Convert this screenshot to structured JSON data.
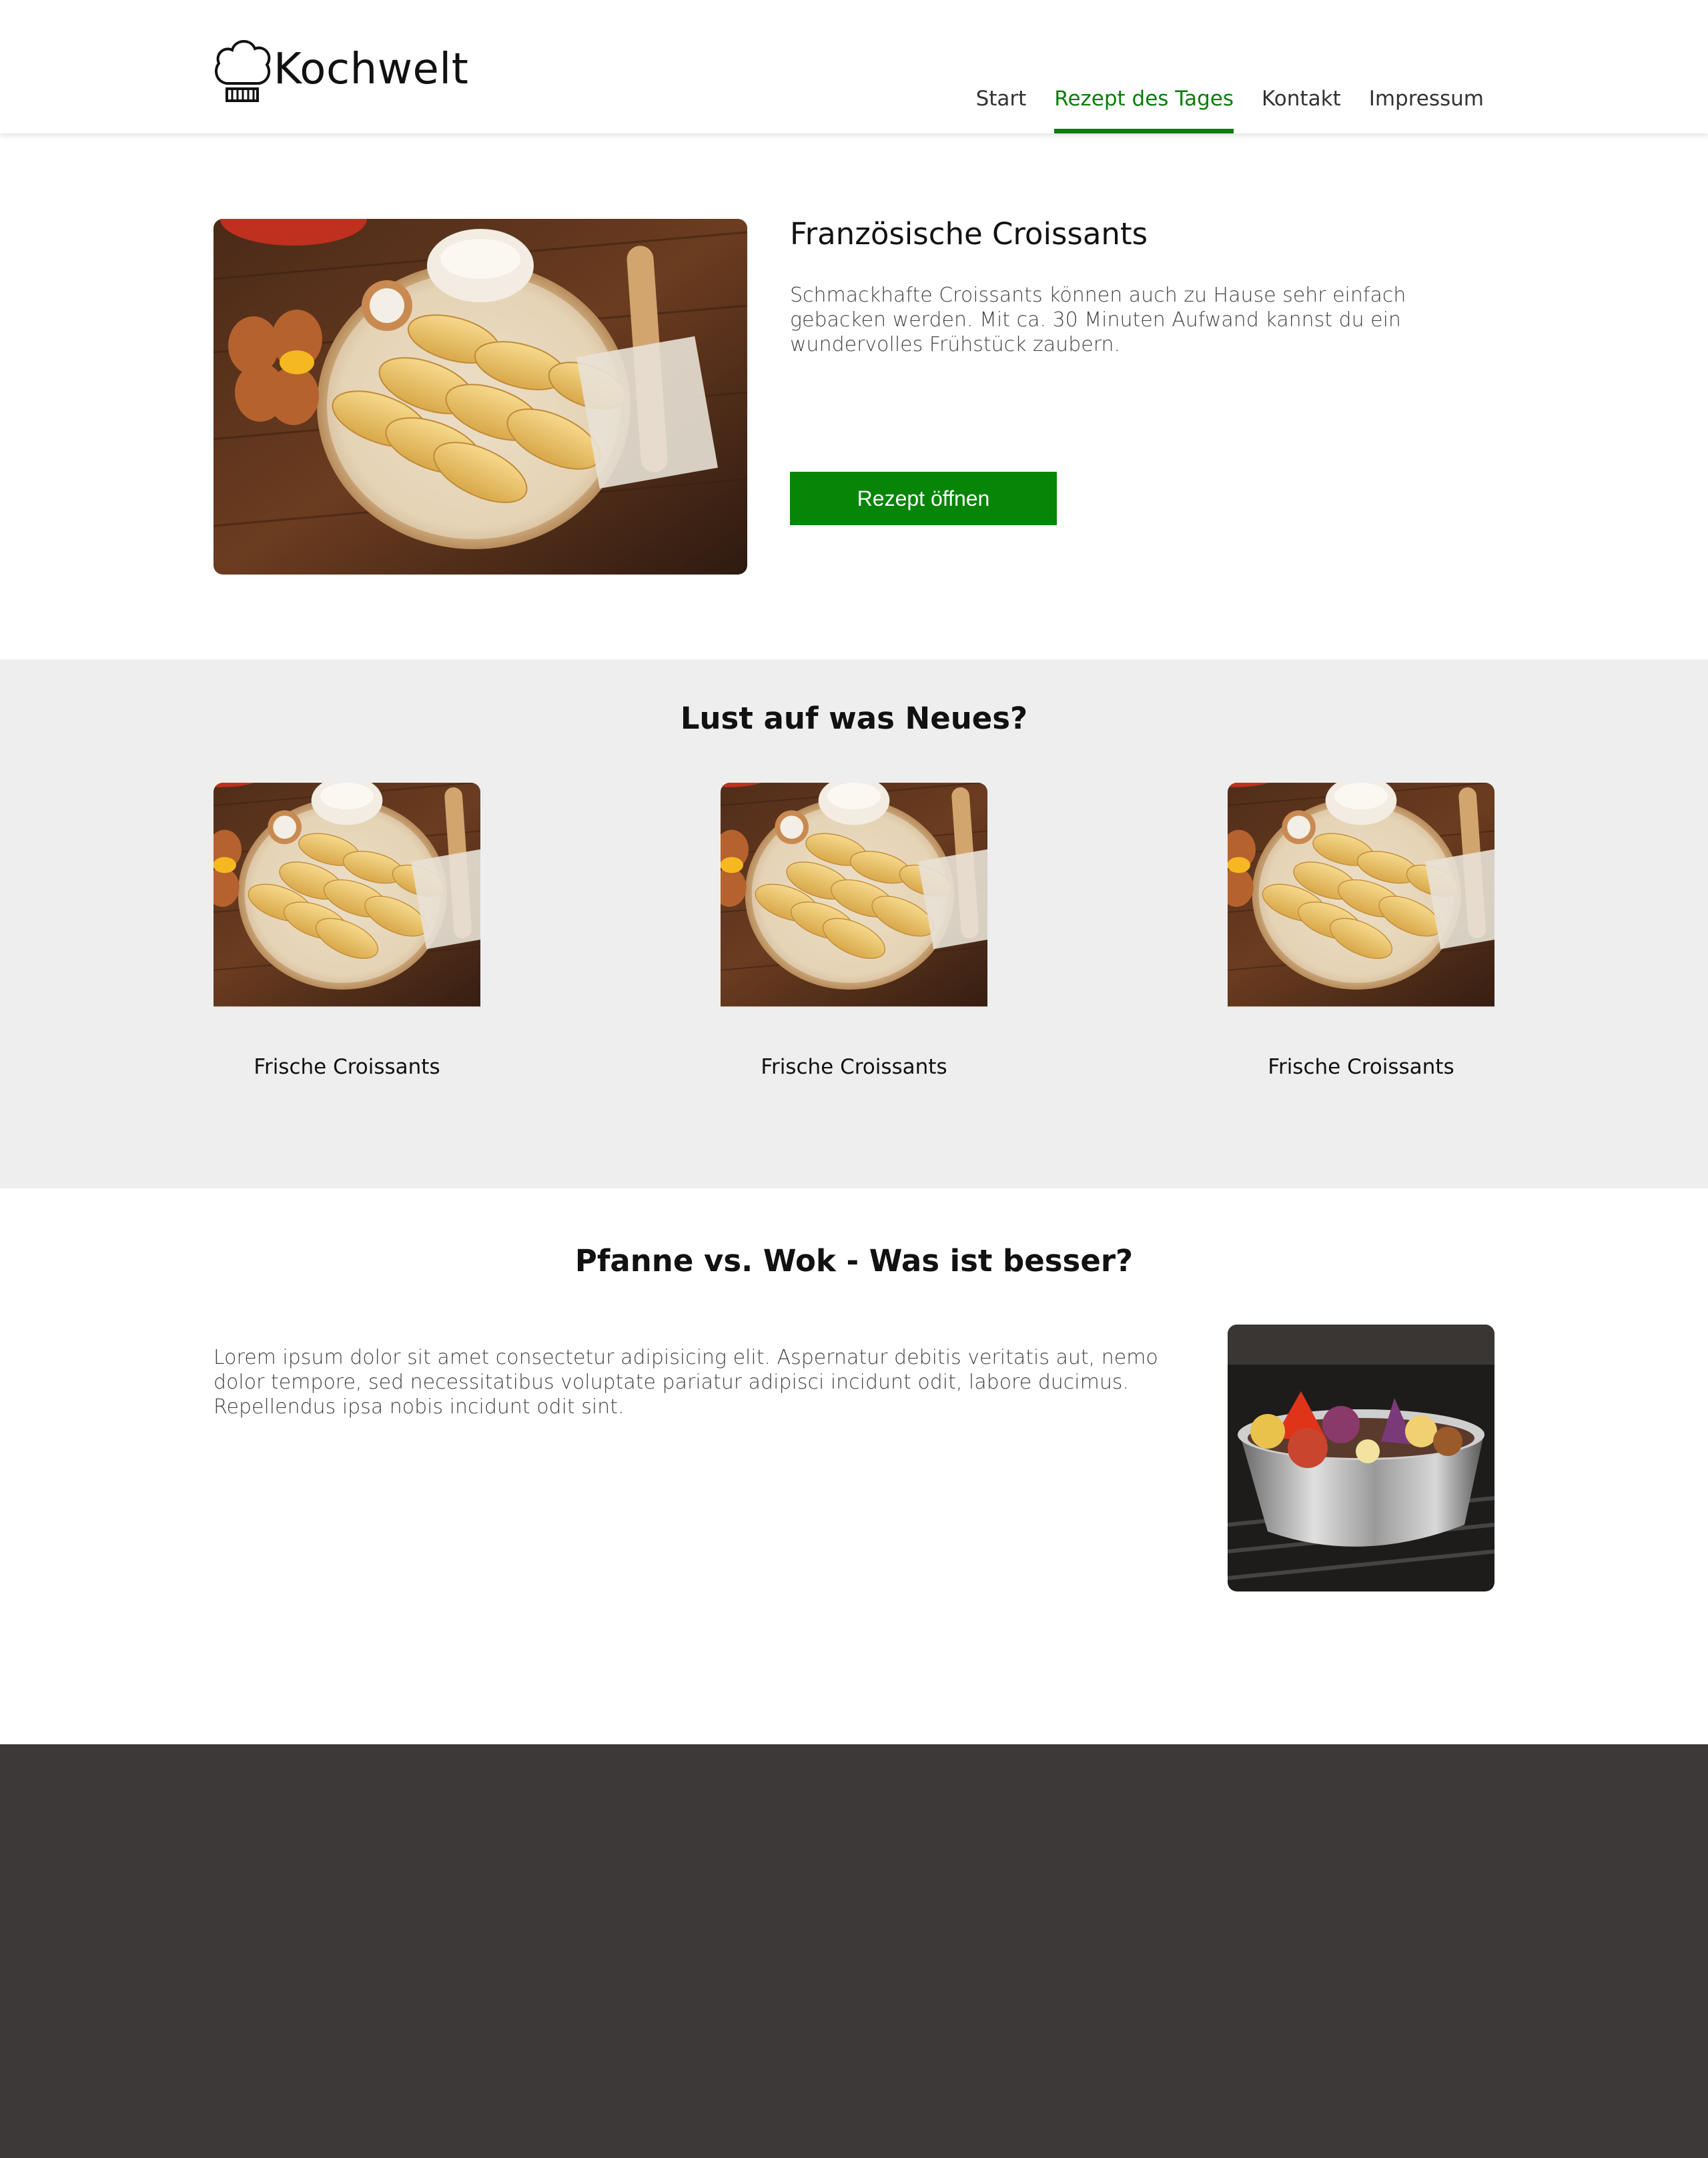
{
  "brand": {
    "name": "Kochwelt",
    "logo_icon": "chef-hat-icon"
  },
  "nav": {
    "items": [
      {
        "label": "Start",
        "active": false
      },
      {
        "label": "Rezept des Tages",
        "active": true
      },
      {
        "label": "Kontakt",
        "active": false
      },
      {
        "label": "Impressum",
        "active": false
      }
    ],
    "active_color": "#0a7d0a"
  },
  "recipe_of_day": {
    "title": "Französische Croissants",
    "description": "Schmackhafte Croissants können auch zu Hause sehr einfach gebacken werden. Mit ca. 30 Minuten Aufwand kannst du ein wundervolles Frühstück zaubern.",
    "button_label": "Rezept öffnen",
    "button_color": "#068506"
  },
  "suggestions": {
    "title": "Lust auf was Neues?",
    "cards": [
      {
        "label": "Frische Croissants"
      },
      {
        "label": "Frische Croissants"
      },
      {
        "label": "Frische Croissants"
      }
    ]
  },
  "article": {
    "title": "Pfanne vs. Wok - Was ist besser?",
    "text": "Lorem ipsum dolor sit amet consectetur adipisicing elit. Aspernatur debitis veritatis aut, nemo dolor tempore, sed necessitatibus voluptate pariatur adipisci incidunt odit, labore ducimus. Repellendus ipsa nobis incidunt odit sint."
  },
  "footer": {
    "background": "#3d3938"
  }
}
